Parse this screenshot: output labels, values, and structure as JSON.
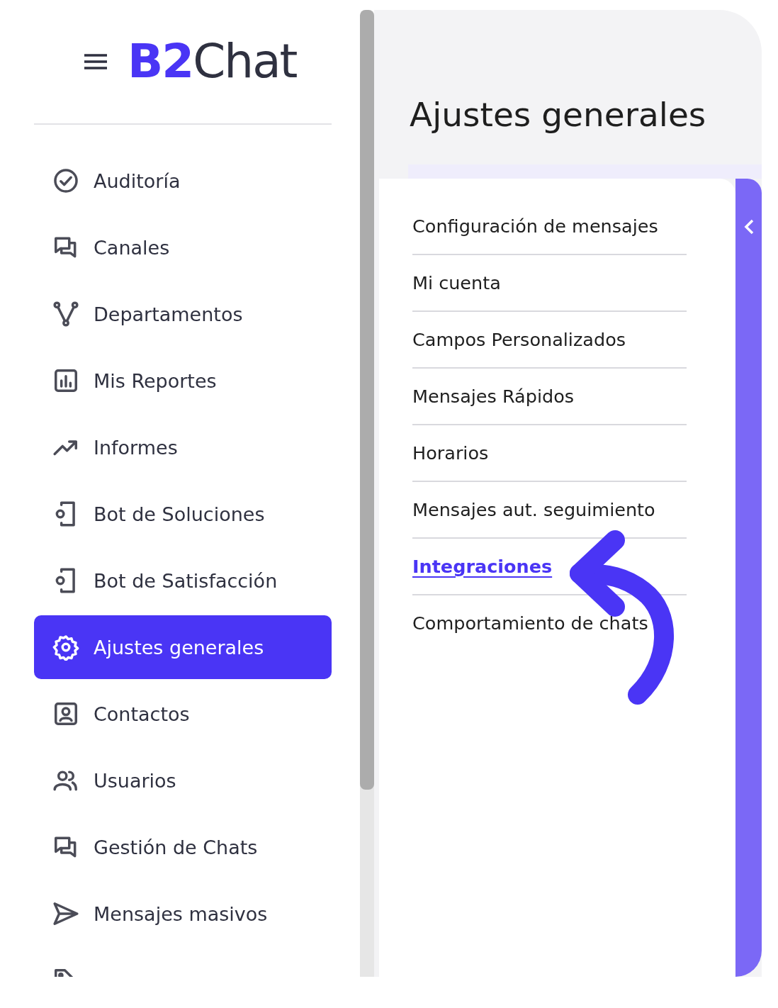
{
  "brand": {
    "logo_mark": "B2",
    "logo_text": "Chat"
  },
  "sidebar": {
    "items": [
      {
        "label": "Auditoría",
        "selected": false
      },
      {
        "label": "Canales",
        "selected": false
      },
      {
        "label": "Departamentos",
        "selected": false
      },
      {
        "label": "Mis Reportes",
        "selected": false
      },
      {
        "label": "Informes",
        "selected": false
      },
      {
        "label": "Bot de Soluciones",
        "selected": false
      },
      {
        "label": "Bot de Satisfacción",
        "selected": false
      },
      {
        "label": "Ajustes generales",
        "selected": true
      },
      {
        "label": "Contactos",
        "selected": false
      },
      {
        "label": "Usuarios",
        "selected": false
      },
      {
        "label": "Gestión de Chats",
        "selected": false
      },
      {
        "label": "Mensajes masivos",
        "selected": false
      },
      {
        "selected": false
      }
    ]
  },
  "page": {
    "title": "Ajustes generales",
    "settings_menu": [
      {
        "label": "Configuración de mensajes",
        "selected": false
      },
      {
        "label": "Mi cuenta",
        "selected": false
      },
      {
        "label": "Campos Personalizados",
        "selected": false
      },
      {
        "label": "Mensajes Rápidos",
        "selected": false
      },
      {
        "label": "Horarios",
        "selected": false
      },
      {
        "label": "Mensajes aut. seguimiento",
        "selected": false
      },
      {
        "label": "Integraciones",
        "selected": true
      },
      {
        "label": "Comportamiento de chats",
        "selected": false
      }
    ],
    "annotation": {
      "kind": "curved-arrow"
    }
  }
}
